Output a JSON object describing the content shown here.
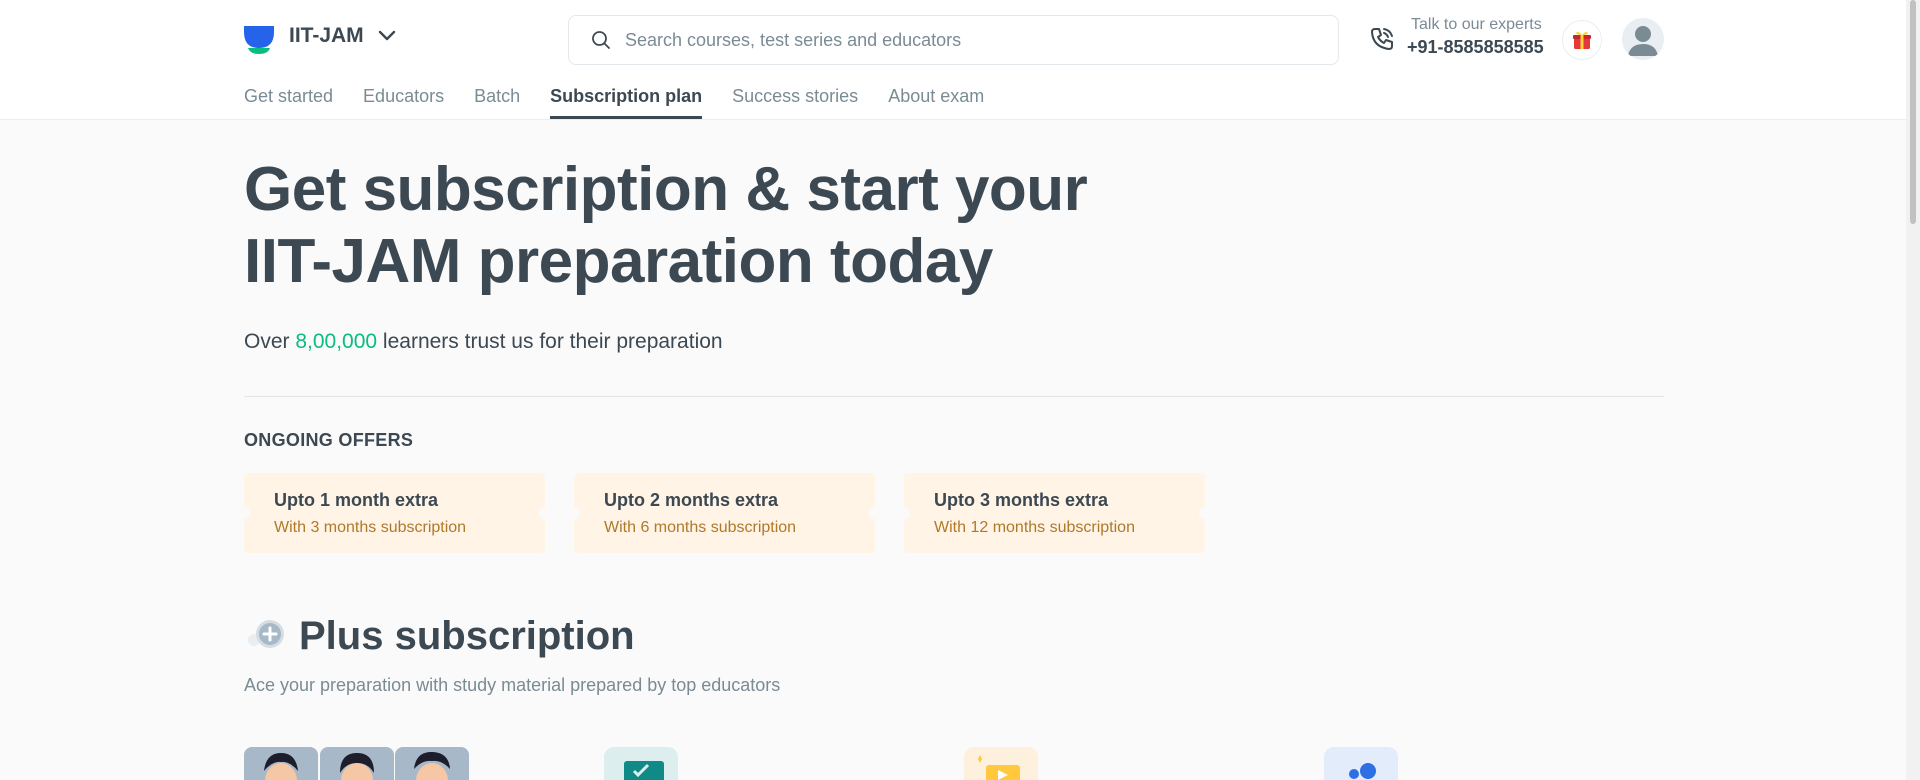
{
  "header": {
    "goal": "IIT-JAM",
    "search_placeholder": "Search courses, test series and educators",
    "talk_label": "Talk to our experts",
    "phone": "+91-8585858585"
  },
  "tabs": [
    "Get started",
    "Educators",
    "Batch",
    "Subscription plan",
    "Success stories",
    "About exam"
  ],
  "hero": {
    "line1": "Get subscription & start your",
    "line2": "IIT-JAM preparation today"
  },
  "trust": {
    "prefix": "Over ",
    "count": "8,00,000",
    "suffix": " learners trust us for their preparation"
  },
  "offers": {
    "title": "ONGOING OFFERS",
    "items": [
      {
        "title": "Upto 1 month extra",
        "sub": "With 3 months subscription"
      },
      {
        "title": "Upto 2 months extra",
        "sub": "With 6 months subscription"
      },
      {
        "title": "Upto 3 months extra",
        "sub": "With 12 months subscription"
      }
    ]
  },
  "plus": {
    "title": "Plus subscription",
    "subtitle": "Ace your preparation with study material prepared by top educators"
  },
  "colors": {
    "accent": "#08bd80",
    "text": "#3c4852",
    "muted": "#7a8b94",
    "offer_bg": "#fff4e6",
    "offer_sub": "#b07929"
  },
  "icons": [
    "logo-icon",
    "chevron-down-icon",
    "search-icon",
    "phone-icon",
    "gift-icon",
    "avatar-icon",
    "plus-badge-icon"
  ]
}
